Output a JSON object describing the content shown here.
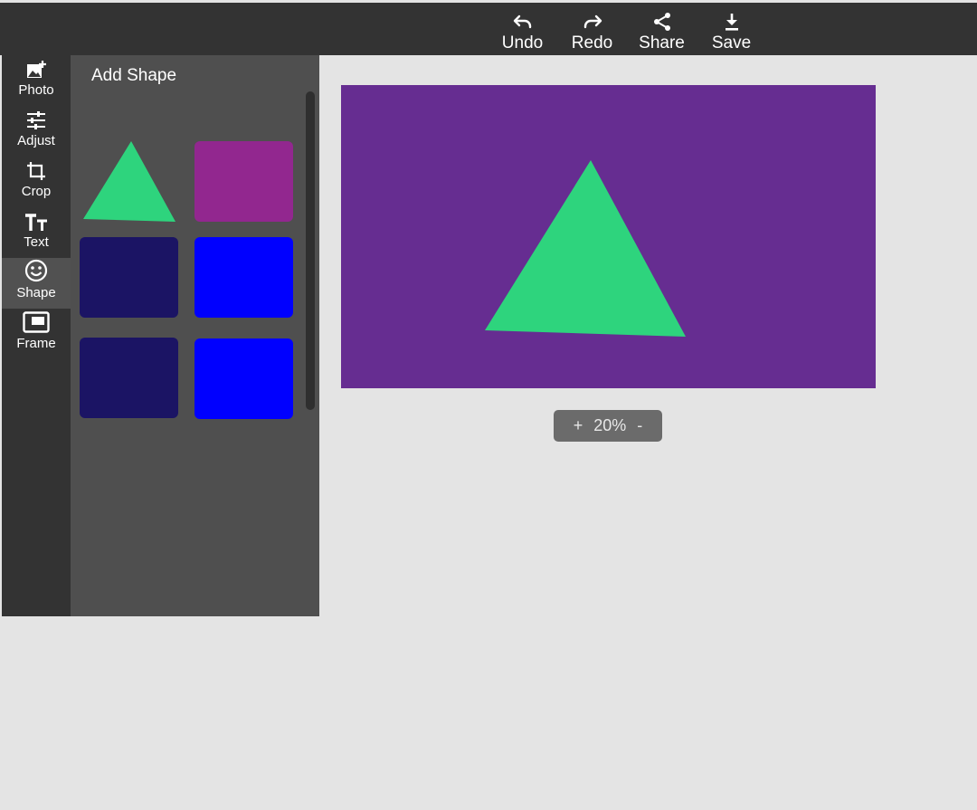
{
  "toolbar": {
    "actions": [
      {
        "label": "Undo",
        "icon": "undo-icon"
      },
      {
        "label": "Redo",
        "icon": "redo-icon"
      },
      {
        "label": "Share",
        "icon": "share-icon"
      },
      {
        "label": "Save",
        "icon": "download-icon"
      }
    ]
  },
  "sidebar": {
    "items": [
      {
        "label": "Photo",
        "icon": "add-photo-icon"
      },
      {
        "label": "Adjust",
        "icon": "sliders-icon"
      },
      {
        "label": "Crop",
        "icon": "crop-icon"
      },
      {
        "label": "Text",
        "icon": "text-size-icon"
      },
      {
        "label": "Shape",
        "icon": "smiley-icon",
        "active": true
      },
      {
        "label": "Frame",
        "icon": "frame-icon"
      }
    ]
  },
  "panel": {
    "title": "Add Shape",
    "shapes": [
      {
        "kind": "triangle",
        "color": "#2ed47d"
      },
      {
        "kind": "rectangle",
        "color": "#92278f"
      },
      {
        "kind": "rectangle",
        "color": "#1b1464"
      },
      {
        "kind": "rectangle",
        "color": "#0000ff"
      },
      {
        "kind": "rectangle",
        "color": "#1b1464"
      },
      {
        "kind": "rectangle",
        "color": "#0000ff"
      }
    ]
  },
  "canvas": {
    "background": "#662d91",
    "shape": {
      "kind": "triangle",
      "color": "#2ed47d"
    }
  },
  "zoom": {
    "plus": "+",
    "value": "20%",
    "minus": "-"
  },
  "colors": {
    "toolbar": "#333333",
    "panel": "#4f4f4f",
    "workspace": "#e4e4e4"
  }
}
